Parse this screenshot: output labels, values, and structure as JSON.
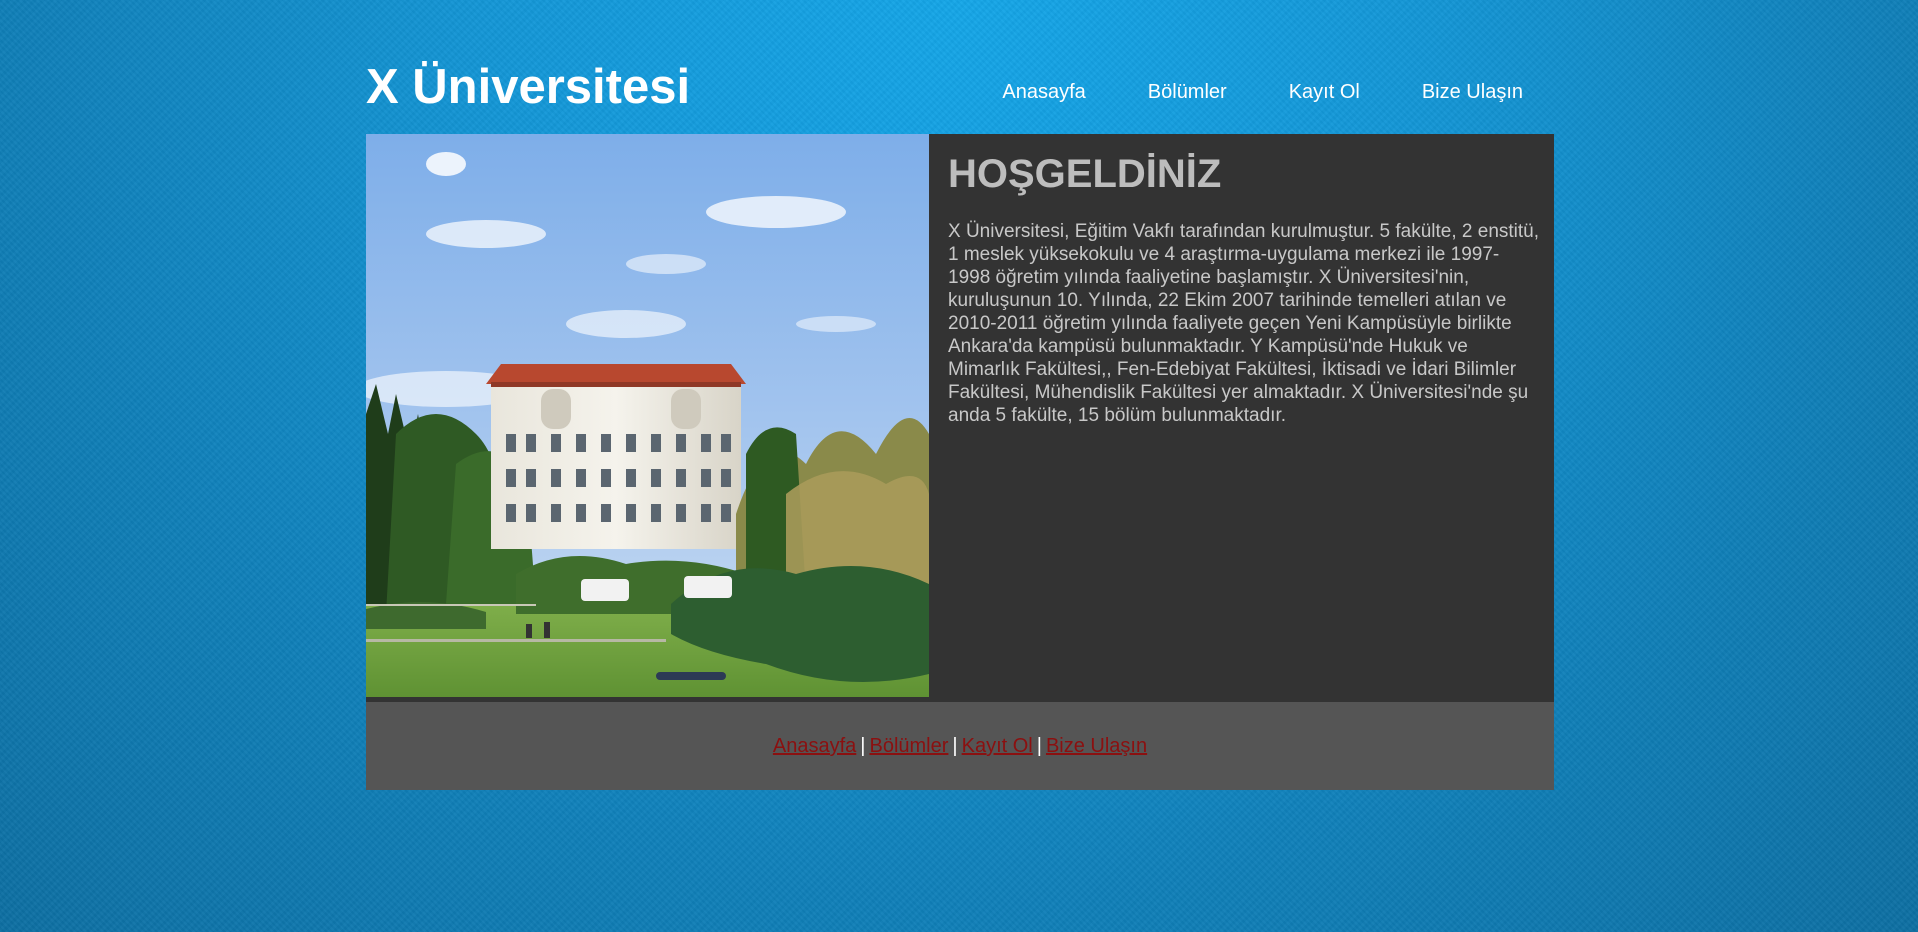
{
  "header": {
    "logo": "X Üniversitesi",
    "nav": [
      "Anasayfa",
      "Bölümler",
      "Kayıt Ol",
      "Bize Ulaşın"
    ]
  },
  "main": {
    "heading": "HOŞGELDİNİZ",
    "intro": "X Üniversitesi, Eğitim Vakfı tarafından kurulmuştur. 5 fakülte, 2 enstitü, 1 meslek yüksekokulu ve 4 araştırma-uygulama merkezi ile 1997-1998 öğretim yılında faaliyetine başlamıştır. X Üniversitesi'nin, kuruluşunun 10. Yılında, 22 Ekim 2007 tarihinde temelleri atılan ve 2010-2011 öğretim yılında faaliyete geçen Yeni Kampüsüyle birlikte Ankara'da kampüsü bulunmaktadır. Y Kampüsü'nde Hukuk ve Mimarlık Fakültesi,, Fen-Edebiyat Fakültesi, İktisadi ve İdari Bilimler Fakültesi, Mühendislik Fakültesi yer almaktadır. X Üniversitesi'nde şu anda 5 fakülte, 15 bölüm bulunmaktadır."
  },
  "footer": {
    "links": [
      "Anasayfa",
      "Bölümler",
      "Kayıt Ol",
      "Bize Ulaşın"
    ],
    "separator": "|"
  },
  "colors": {
    "background": "#1396d6",
    "main_panel": "#333333",
    "footer_panel": "#555555",
    "footer_link": "#8b1010",
    "heading": "#bdbdbd"
  }
}
